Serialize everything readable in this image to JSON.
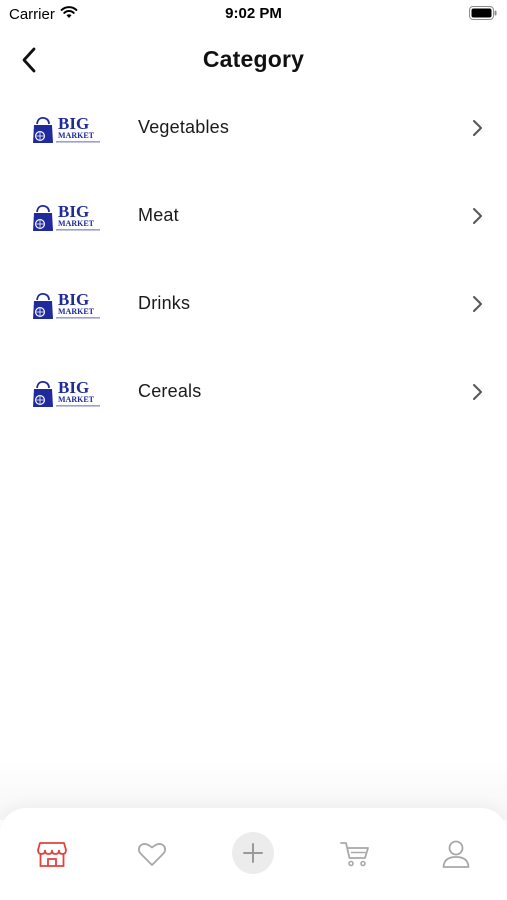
{
  "status_bar": {
    "carrier": "Carrier",
    "time": "9:02 PM"
  },
  "header": {
    "title": "Category"
  },
  "logo": {
    "line1": "BIG",
    "line2": "MARKET"
  },
  "categories": [
    {
      "label": "Vegetables"
    },
    {
      "label": "Meat"
    },
    {
      "label": "Drinks"
    },
    {
      "label": "Cereals"
    }
  ],
  "tab_bar": {
    "items": [
      {
        "icon": "store-icon",
        "active": true
      },
      {
        "icon": "heart-icon",
        "active": false
      },
      {
        "icon": "plus-icon",
        "active": false
      },
      {
        "icon": "cart-icon",
        "active": false
      },
      {
        "icon": "user-icon",
        "active": false
      }
    ]
  },
  "colors": {
    "accent": "#e5403a",
    "logo_blue": "#1f2a9c",
    "icon_gray": "#a8a8a8"
  }
}
